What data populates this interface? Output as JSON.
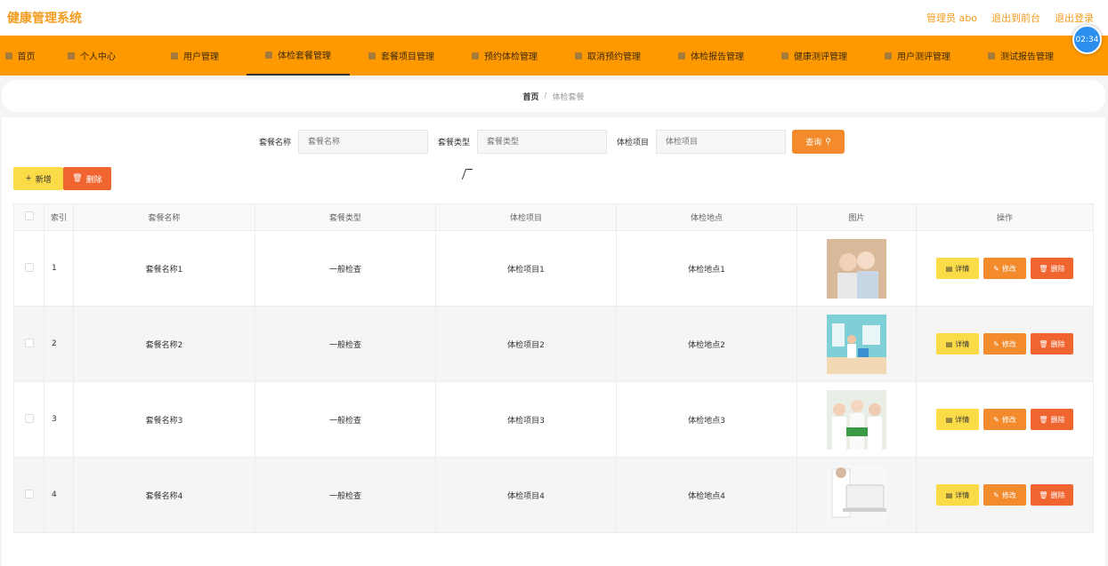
{
  "header": {
    "app_title": "健康管理系统",
    "admin_label": "管理员 abo",
    "front_label": "退出到前台",
    "logout_label": "退出登录",
    "clock": "02:34"
  },
  "nav": [
    {
      "label": "首页",
      "icon": "home-icon"
    },
    {
      "label": "个人中心",
      "icon": "user-icon"
    },
    {
      "label": "用户管理",
      "icon": "users-icon"
    },
    {
      "label": "体检套餐管理",
      "icon": "package-icon",
      "active": true
    },
    {
      "label": "套餐项目管理",
      "icon": "chart-icon"
    },
    {
      "label": "预约体检管理",
      "icon": "pin-icon"
    },
    {
      "label": "取消预约管理",
      "icon": "chat-icon"
    },
    {
      "label": "体检报告管理",
      "icon": "report-icon"
    },
    {
      "label": "健康测评管理",
      "icon": "flag-icon"
    },
    {
      "label": "用户测评管理",
      "icon": "doc-icon"
    },
    {
      "label": "测试报告管理",
      "icon": "file-icon"
    }
  ],
  "breadcrumb": {
    "home": "首页",
    "separator": "/",
    "current": "体检套餐"
  },
  "search": {
    "name_label": "套餐名称",
    "name_placeholder": "套餐名称",
    "type_label": "套餐类型",
    "type_placeholder": "套餐类型",
    "item_label": "体检项目",
    "item_placeholder": "体检项目",
    "button": "查询"
  },
  "actions": {
    "add": "新增",
    "delete": "删除"
  },
  "table": {
    "headers": [
      "索引",
      "套餐名称",
      "套餐类型",
      "体检项目",
      "体检地点",
      "图片",
      "操作"
    ],
    "ops": {
      "detail": "详情",
      "edit": "修改",
      "delete": "删除"
    },
    "rows": [
      {
        "index": "1",
        "name": "套餐名称1",
        "type": "一般检查",
        "item": "体检项目1",
        "place": "体检地点1"
      },
      {
        "index": "2",
        "name": "套餐名称2",
        "type": "一般检查",
        "item": "体检项目2",
        "place": "体检地点2"
      },
      {
        "index": "3",
        "name": "套餐名称3",
        "type": "一般检查",
        "item": "体检项目3",
        "place": "体检地点3"
      },
      {
        "index": "4",
        "name": "套餐名称4",
        "type": "一般检查",
        "item": "体检项目4",
        "place": "体检地点4"
      }
    ]
  }
}
